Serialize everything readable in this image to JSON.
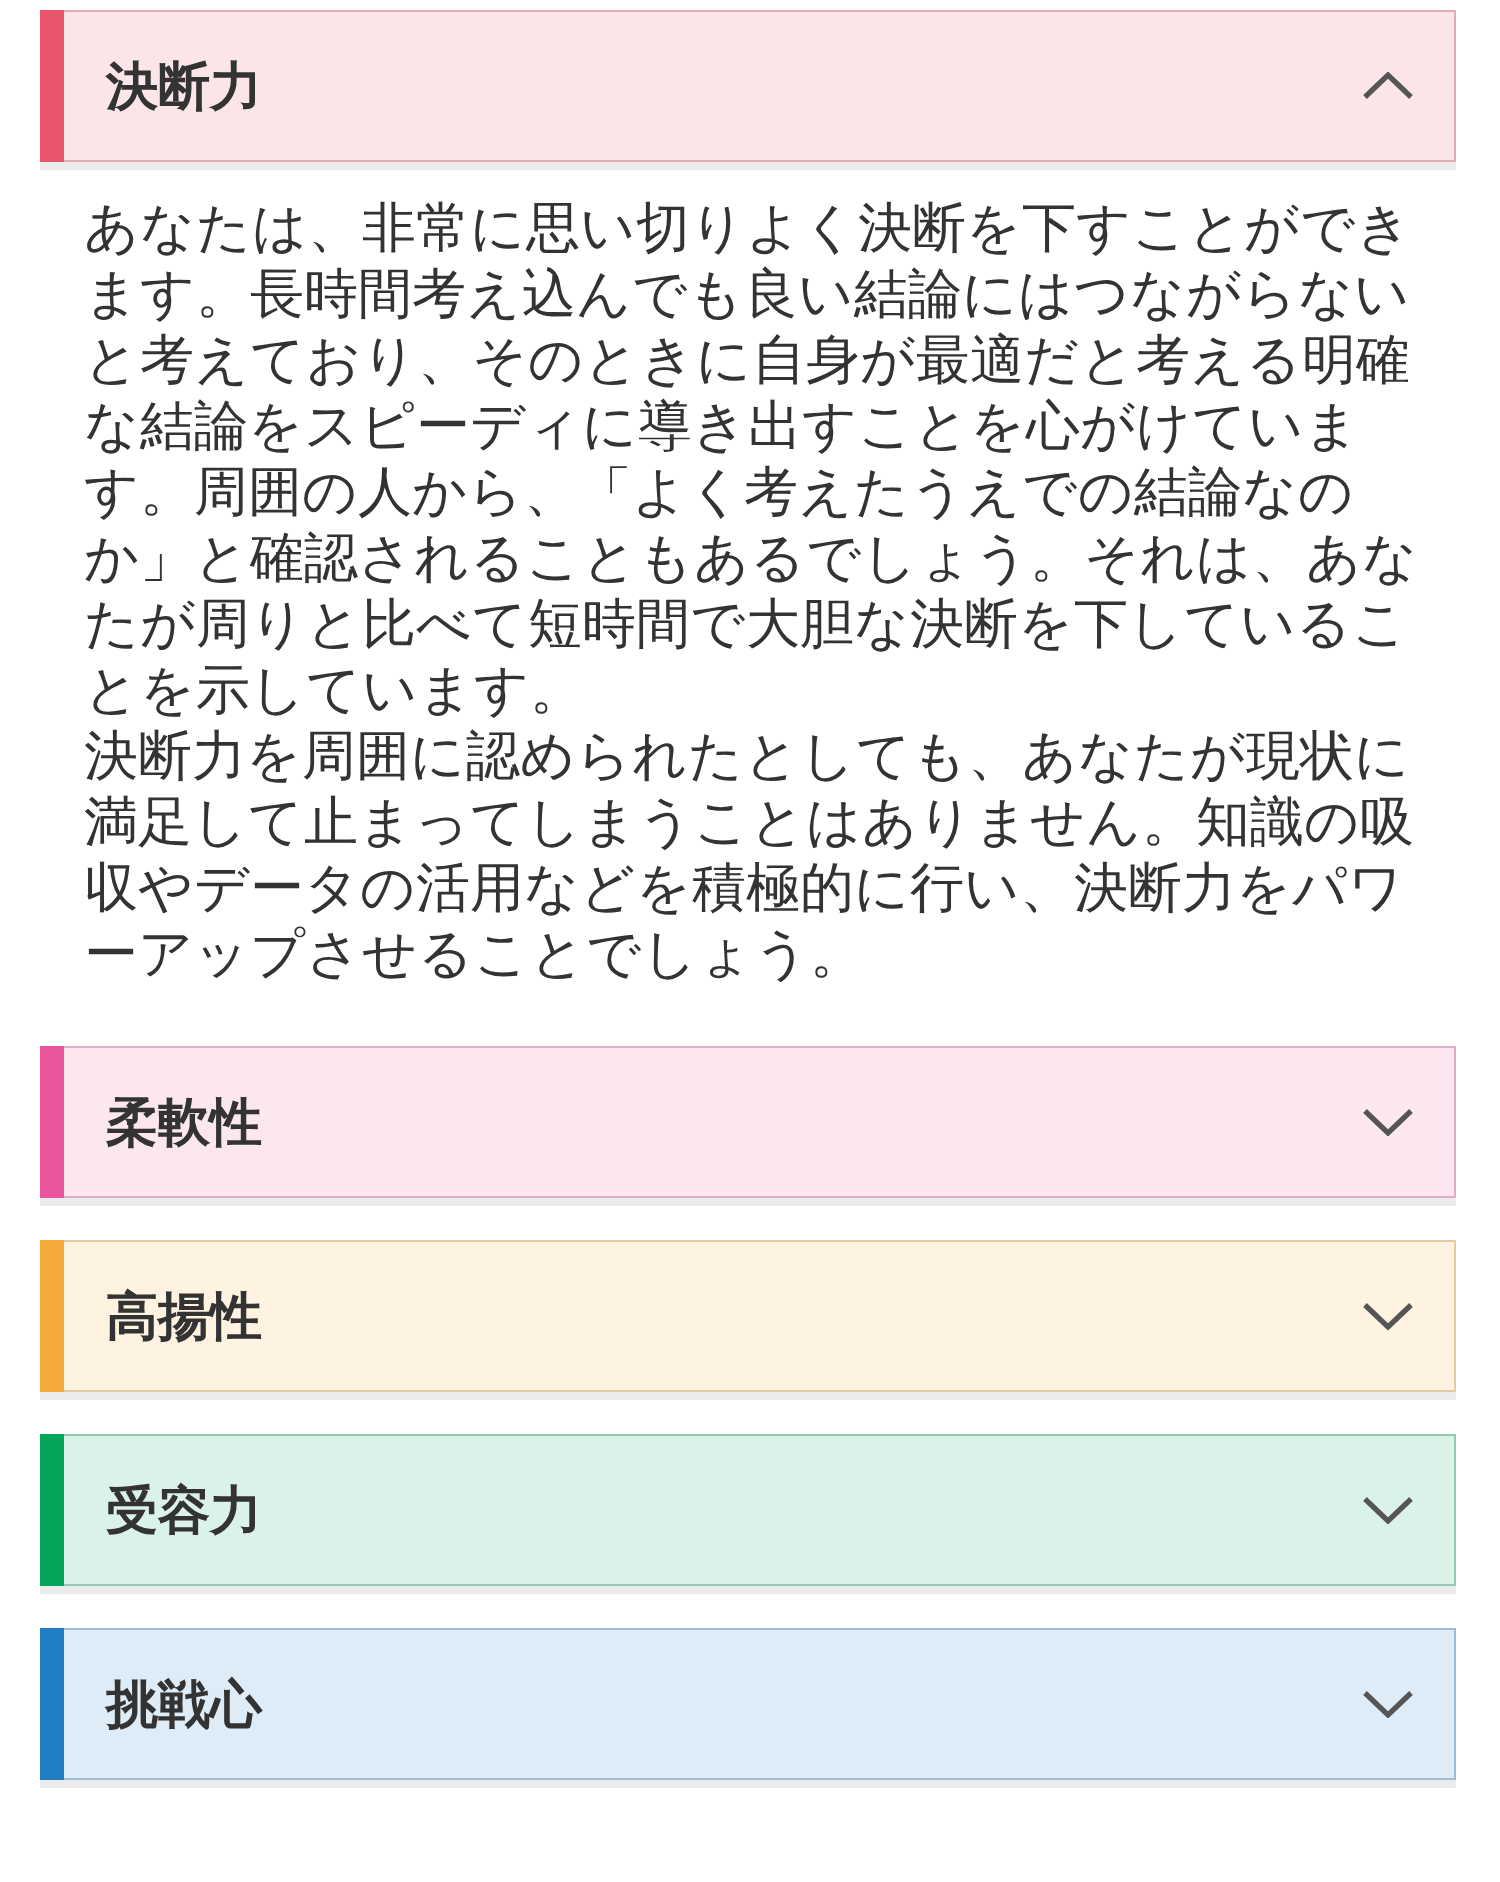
{
  "sections": [
    {
      "title": "決断力",
      "color": "#e8546b",
      "expanded": true,
      "paragraphs": [
        "あなたは、非常に思い切りよく決断を下すことができます。長時間考え込んでも良い結論にはつながらないと考えており、そのときに自身が最適だと考える明確な結論をスピーディに導き出すことを心がけています。周囲の人から、「よく考えたうえでの結論なのか」と確認されることもあるでしょう。それは、あなたが周りと比べて短時間で大胆な決断を下していることを示しています。",
        "決断力を周囲に認められたとしても、あなたが現状に満足して止まってしまうことはありません。知識の吸収やデータの活用などを積極的に行い、決断力をパワーアップさせることでしょう。"
      ]
    },
    {
      "title": "柔軟性",
      "color": "#e8559a",
      "expanded": false
    },
    {
      "title": "高揚性",
      "color": "#f5ab3a",
      "expanded": false
    },
    {
      "title": "受容力",
      "color": "#06a55c",
      "expanded": false
    },
    {
      "title": "挑戦心",
      "color": "#1f7ec4",
      "expanded": false
    }
  ]
}
